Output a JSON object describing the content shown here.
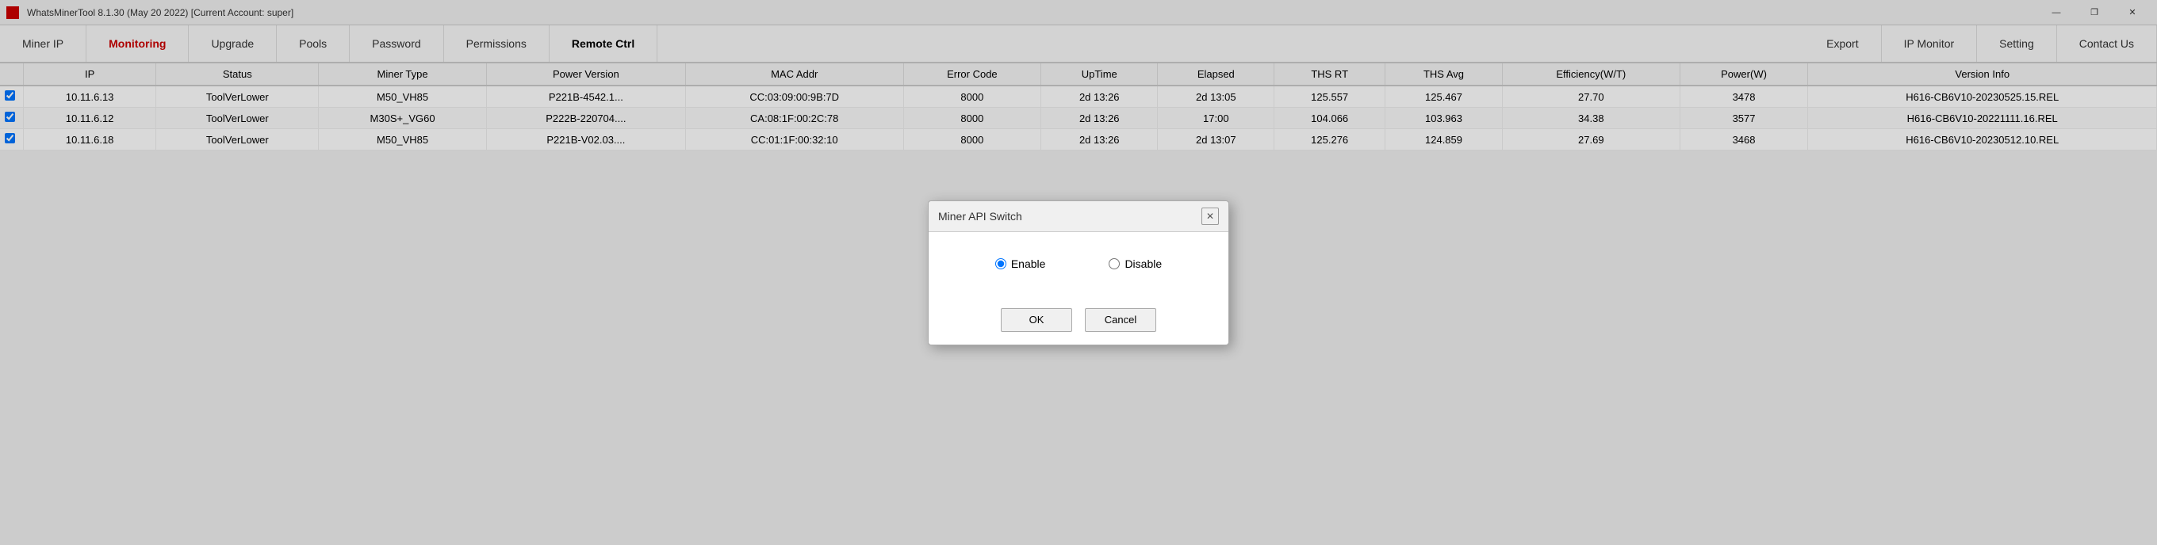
{
  "titleBar": {
    "title": "WhatsMinerTool 8.1.30 (May 20 2022) [Current Account: super]",
    "minimize": "—",
    "maximize": "❐",
    "close": "✕"
  },
  "nav": {
    "buttons": [
      {
        "id": "miner-ip",
        "label": "Miner IP",
        "active": false
      },
      {
        "id": "monitoring",
        "label": "Monitoring",
        "active": true
      },
      {
        "id": "upgrade",
        "label": "Upgrade",
        "active": false
      },
      {
        "id": "pools",
        "label": "Pools",
        "active": false
      },
      {
        "id": "password",
        "label": "Password",
        "active": false
      },
      {
        "id": "permissions",
        "label": "Permissions",
        "active": false
      },
      {
        "id": "remote-ctrl",
        "label": "Remote Ctrl",
        "active": true,
        "bold": true
      },
      {
        "id": "export",
        "label": "Export",
        "active": false
      },
      {
        "id": "ip-monitor",
        "label": "IP Monitor",
        "active": false
      },
      {
        "id": "setting",
        "label": "Setting",
        "active": false
      },
      {
        "id": "contact-us",
        "label": "Contact Us",
        "active": false
      }
    ]
  },
  "table": {
    "columns": [
      "IP",
      "Status",
      "Miner Type",
      "Power Version",
      "MAC Addr",
      "Error Code",
      "UpTime",
      "Elapsed",
      "THS RT",
      "THS Avg",
      "Efficiency(W/T)",
      "Power(W)",
      "Version Info"
    ],
    "rows": [
      {
        "checked": true,
        "ip": "10.11.6.13",
        "status": "ToolVerLower",
        "minerType": "M50_VH85",
        "powerVersion": "P221B-4542.1...",
        "macAddr": "CC:03:09:00:9B:7D",
        "errorCode": "8000",
        "upTime": "2d 13:26",
        "elapsed": "2d 13:05",
        "thsRt": "125.557",
        "thsAvg": "125.467",
        "efficiency": "27.70",
        "power": "3478",
        "versionInfo": "H616-CB6V10-20230525.15.REL"
      },
      {
        "checked": true,
        "ip": "10.11.6.12",
        "status": "ToolVerLower",
        "minerType": "M30S+_VG60",
        "powerVersion": "P222B-220704....",
        "macAddr": "CA:08:1F:00:2C:78",
        "errorCode": "8000",
        "upTime": "2d 13:26",
        "elapsed": "17:00",
        "thsRt": "104.066",
        "thsAvg": "103.963",
        "efficiency": "34.38",
        "power": "3577",
        "versionInfo": "H616-CB6V10-20221111.16.REL"
      },
      {
        "checked": true,
        "ip": "10.11.6.18",
        "status": "ToolVerLower",
        "minerType": "M50_VH85",
        "powerVersion": "P221B-V02.03....",
        "macAddr": "CC:01:1F:00:32:10",
        "errorCode": "8000",
        "upTime": "2d 13:26",
        "elapsed": "2d 13:07",
        "thsRt": "125.276",
        "thsAvg": "124.859",
        "efficiency": "27.69",
        "power": "3468",
        "versionInfo": "H616-CB6V10-20230512.10.REL"
      }
    ]
  },
  "dialog": {
    "title": "Miner API Switch",
    "closeBtn": "✕",
    "enableLabel": "Enable",
    "disableLabel": "Disable",
    "okLabel": "OK",
    "cancelLabel": "Cancel",
    "selectedOption": "enable"
  }
}
